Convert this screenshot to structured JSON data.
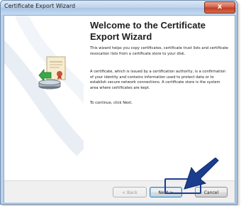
{
  "window": {
    "title": "Certificate Export Wizard",
    "close_glyph": "x"
  },
  "main": {
    "heading": "Welcome to the Certificate Export Wizard",
    "paragraphs": [
      "This wizard helps you copy certificates, certificate trust lists and certificate revocation lists from a certificate store to your disk.",
      "A certificate, which is issued by a certification authority, is a confirmation of your identity and contains information used to protect data or to establish secure network connections. A certificate store is the system area where certificates are kept.",
      "To continue, click Next."
    ]
  },
  "buttons": {
    "back": "< Back",
    "next": "Next >",
    "cancel": "Cancel"
  },
  "icons": {
    "wizard": "certificate-export-icon",
    "pointer": "pointer-arrow-icon"
  },
  "colors": {
    "titlebar": "#bdd3ec",
    "close": "#c03a1f",
    "arrow": "#1a3d8f"
  }
}
